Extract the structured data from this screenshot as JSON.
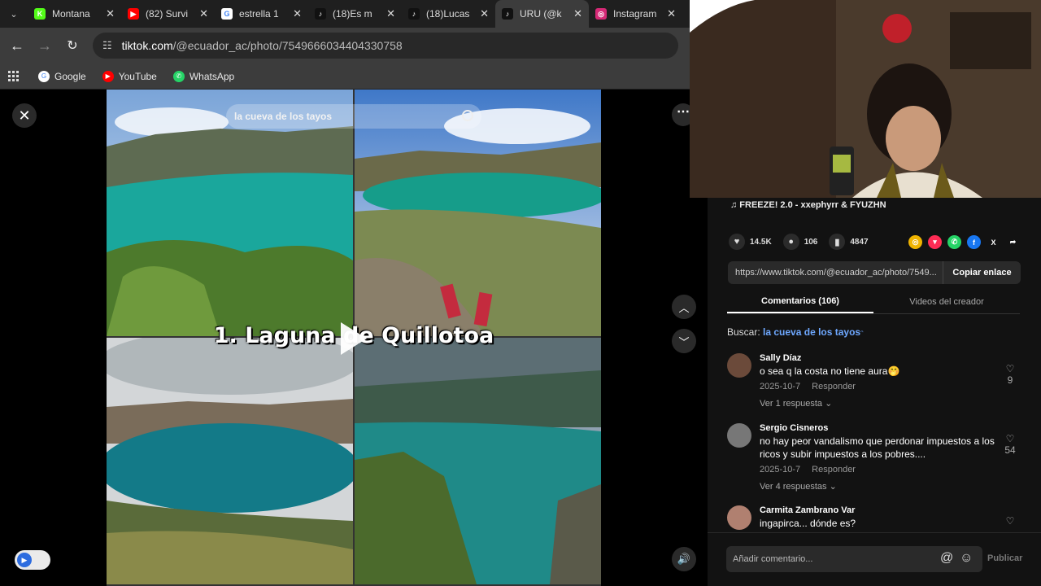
{
  "browser": {
    "tabs": [
      {
        "title": "Montana",
        "icon": "kick-icon",
        "color": "#53fc18",
        "glyph": "K",
        "active": false
      },
      {
        "title": "(82) Survi",
        "icon": "youtube-icon",
        "color": "#ff0000",
        "glyph": "▶",
        "active": false
      },
      {
        "title": "estrella 1",
        "icon": "google-icon",
        "color": "#ffffff",
        "glyph": "G",
        "active": false
      },
      {
        "title": "(18)Es m",
        "icon": "tiktok-icon",
        "color": "#111111",
        "glyph": "♪",
        "active": false
      },
      {
        "title": "(18)Lucas",
        "icon": "tiktok-icon",
        "color": "#111111",
        "glyph": "♪",
        "active": false
      },
      {
        "title": "URU (@k",
        "icon": "tiktok-icon",
        "color": "#111111",
        "glyph": "♪",
        "active": true
      },
      {
        "title": "Instagram",
        "icon": "instagram-icon",
        "color": "#d62976",
        "glyph": "◎",
        "active": false
      }
    ],
    "url_host": "tiktok.com",
    "url_path": "/@ecuador_ac/photo/7549666034404330758",
    "bookmarks": [
      {
        "label": "Google",
        "icon": "google-icon",
        "color": "#ffffff",
        "glyph": "G"
      },
      {
        "label": "YouTube",
        "icon": "youtube-icon",
        "color": "#ff0000",
        "glyph": "▶"
      },
      {
        "label": "WhatsApp",
        "icon": "whatsapp-icon",
        "color": "#25d366",
        "glyph": "✆"
      }
    ]
  },
  "viewer": {
    "search_text": "la cueva de los tayos",
    "caption": "1. Laguna de Quillotoa"
  },
  "post": {
    "music": "♫  FREEZE! 2.0 - xxephyrr & FYUZHN",
    "likes": "14.5K",
    "comments": "106",
    "saves": "4847",
    "link": "https://www.tiktok.com/@ecuador_ac/photo/7549...",
    "copy_label": "Copiar enlace",
    "tab_comments": "Comentarios (106)",
    "tab_videos": "Videos del creador",
    "search_label": "Buscar:",
    "search_term": "la cueva de los tayos"
  },
  "comments": [
    {
      "user": "Sally Díaz",
      "text": "o sea q la costa no tiene aura🤭",
      "date": "2025-10-7",
      "reply": "Responder",
      "replies": "Ver 1 respuesta ⌄",
      "likes": "9",
      "avatar": "#6b4a3a"
    },
    {
      "user": "Sergio Cisneros",
      "text": "no hay peor vandalismo que perdonar impuestos a los ricos y subir impuestos a los pobres....",
      "date": "2025-10-7",
      "reply": "Responder",
      "replies": "Ver 4 respuestas ⌄",
      "likes": "54",
      "avatar": "#777777"
    },
    {
      "user": "Carmita Zambrano Var",
      "text": "ingapirca... dónde es?",
      "date": "",
      "reply": "",
      "replies": "",
      "likes": "",
      "avatar": "#b08070"
    }
  ],
  "composer": {
    "placeholder": "Añadir comentario...",
    "post_label": "Publicar"
  }
}
